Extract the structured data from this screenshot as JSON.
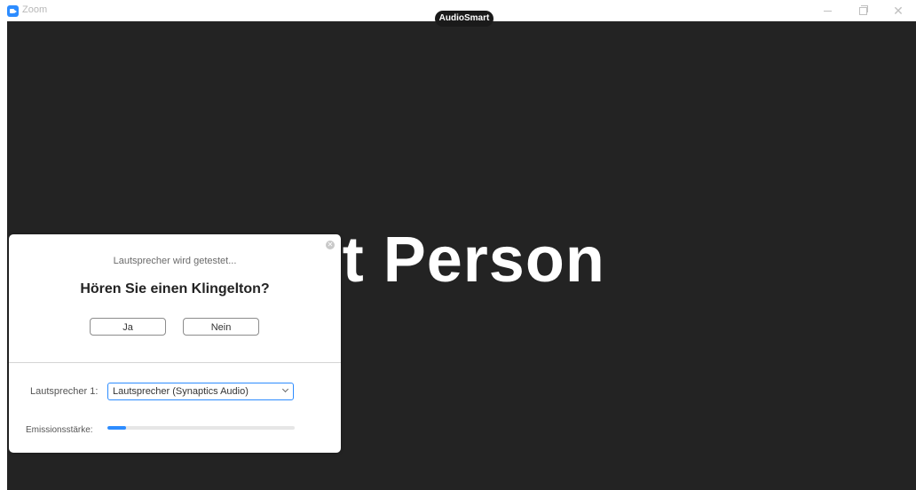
{
  "window": {
    "app_title": "Zoom",
    "brand_label": "AudioSmart",
    "controls": {
      "minimize_icon": "minimize-icon",
      "maximize_icon": "restore-icon",
      "close_icon": "close-icon"
    }
  },
  "video": {
    "participant_name": "Test Person"
  },
  "dialog": {
    "status_text": "Lautsprecher wird getestet...",
    "question": "Hören Sie einen Klingelton?",
    "yes_label": "Ja",
    "no_label": "Nein",
    "speaker_label": "Lautsprecher 1:",
    "speaker_selected": "Lautsprecher (Synaptics Audio)",
    "level_label": "Emissionsstärke:",
    "output_level_percent": 10
  },
  "colors": {
    "accent": "#2d8cff",
    "video_background": "#232323",
    "dialog_background": "#ffffff"
  }
}
